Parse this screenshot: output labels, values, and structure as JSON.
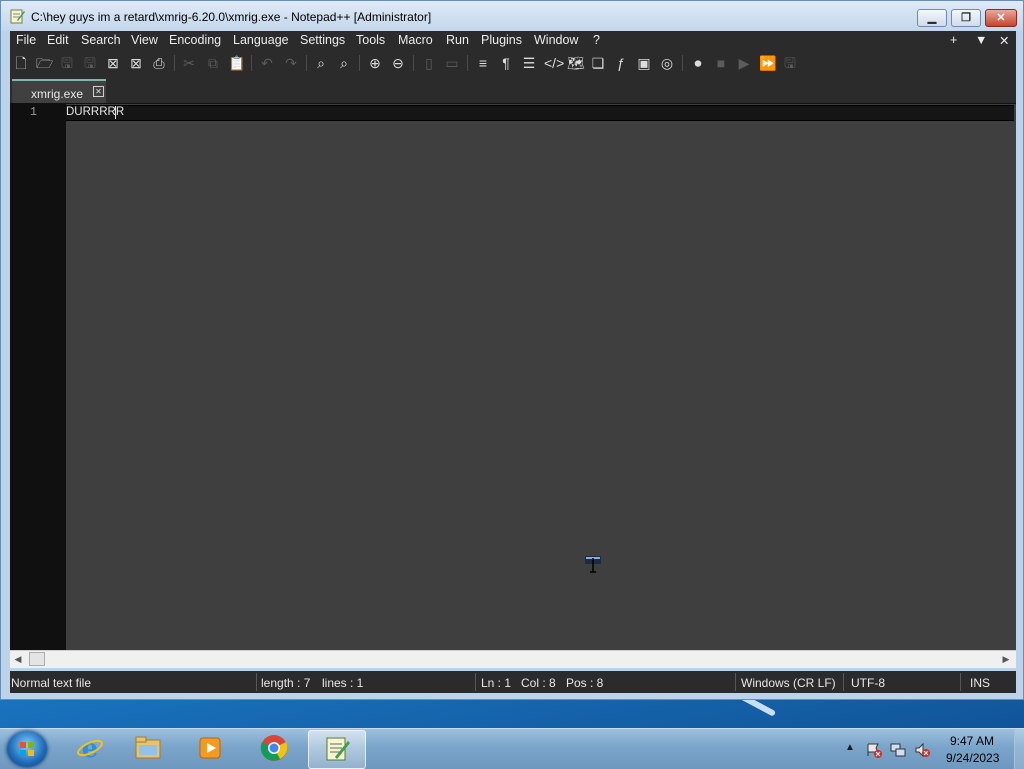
{
  "window": {
    "title": "C:\\hey guys im a retard\\xmrig-6.20.0\\xmrig.exe - Notepad++ [Administrator]",
    "buttons": {
      "minimize": "minimize",
      "maximize": "maximize",
      "close": "close"
    }
  },
  "menu": {
    "items": [
      "File",
      "Edit",
      "Search",
      "View",
      "Encoding",
      "Language",
      "Settings",
      "Tools",
      "Macro",
      "Run",
      "Plugins",
      "Window",
      "?"
    ],
    "right": [
      "+",
      "▼",
      "✕"
    ]
  },
  "toolbar": {
    "icons": [
      "new-file-icon",
      "open-file-icon",
      "save-icon",
      "save-all-icon",
      "close-icon",
      "close-all-icon",
      "print-icon",
      "cut-icon",
      "copy-icon",
      "paste-icon",
      "undo-icon",
      "redo-icon",
      "find-icon",
      "replace-icon",
      "zoom-in-icon",
      "zoom-out-icon",
      "sync-vertical-icon",
      "sync-horizontal-icon",
      "word-wrap-icon",
      "show-all-chars-icon",
      "indent-guide-icon",
      "language-icon",
      "document-map-icon",
      "document-list-icon",
      "function-list-icon",
      "folder-as-workspace-icon",
      "monitoring-icon",
      "record-macro-icon",
      "stop-macro-icon",
      "play-macro-icon",
      "run-macro-multiple-icon",
      "save-macro-icon"
    ]
  },
  "tabs": [
    {
      "label": "xmrig.exe",
      "active": true
    }
  ],
  "editor": {
    "lines": [
      {
        "number": "1",
        "text": "DURRRRR"
      }
    ]
  },
  "status": {
    "file_type": "Normal text file",
    "length": "length : 7",
    "lines": "lines : 1",
    "ln": "Ln : 1",
    "col": "Col : 8",
    "pos": "Pos : 8",
    "eol": "Windows (CR LF)",
    "encoding": "UTF-8",
    "mode": "INS"
  },
  "taskbar": {
    "apps": [
      "internet-explorer-icon",
      "file-explorer-icon",
      "media-player-icon",
      "chrome-icon",
      "notepad-plus-plus-icon"
    ],
    "active_app": "notepad-plus-plus-icon"
  },
  "clock": {
    "time": "9:47 AM",
    "date": "9/24/2023"
  }
}
